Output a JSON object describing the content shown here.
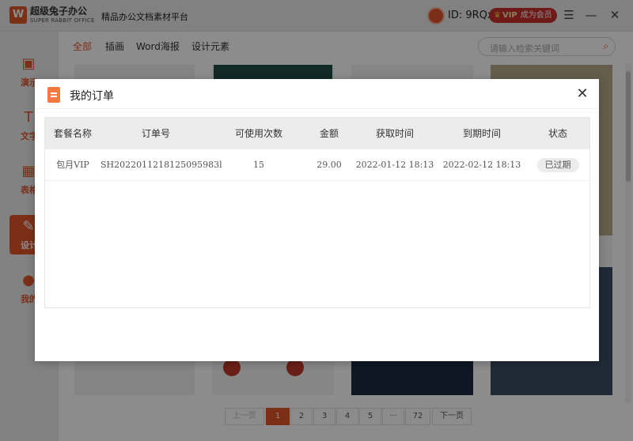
{
  "app": {
    "logo_letter": "W",
    "brand_name": "超级兔子办公",
    "brand_sub": "SUPER RABBIT OFFICE",
    "platform": "精品办公文档素材平台",
    "user_id": "ID: 9RQx",
    "vip_badge": "VIP",
    "vip_cta": "成为会员"
  },
  "sidebar": {
    "items": [
      {
        "label": "演示",
        "icon": "presentation-icon"
      },
      {
        "label": "文字",
        "icon": "text-doc-icon"
      },
      {
        "label": "表格",
        "icon": "table-icon"
      },
      {
        "label": "设计",
        "icon": "design-icon"
      },
      {
        "label": "我的",
        "icon": "user-icon"
      }
    ]
  },
  "categories": [
    "全部",
    "插画",
    "Word海报",
    "设计元素"
  ],
  "search": {
    "placeholder": "请输入检索关键词"
  },
  "pagination": {
    "prev": "上一页",
    "pages": [
      "1",
      "2",
      "3",
      "4",
      "5",
      "···",
      "72"
    ],
    "next": "下一页",
    "current": "1"
  },
  "modal": {
    "title": "我的订单",
    "columns": [
      "套餐名称",
      "订单号",
      "可使用次数",
      "金额",
      "获取时间",
      "到期时间",
      "状态"
    ],
    "rows": [
      {
        "package": "包月VIP",
        "order_no": "SH2022011218125095983l",
        "uses": "15",
        "amount": "29.00",
        "acquired": "2022-01-12 18:13",
        "expires": "2022-02-12 18:13",
        "status": "已过期"
      }
    ]
  }
}
